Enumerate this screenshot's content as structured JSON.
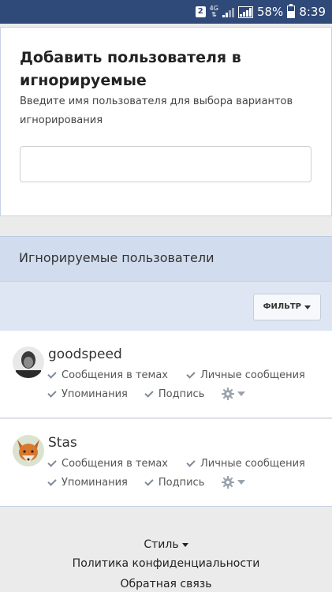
{
  "status_bar": {
    "sim_slot": "2",
    "network": "4G",
    "battery": "58%",
    "time": "8:39"
  },
  "add_box": {
    "title": "Добавить пользователя в игнорируемые",
    "hint": "Введите имя пользователя для выбора вариантов игнорирования",
    "input_value": "",
    "input_placeholder": ""
  },
  "ignored": {
    "title": "Игнорируемые пользователи",
    "filter_label": "ФИЛЬТР",
    "users": [
      {
        "name": "goodspeed",
        "options": [
          "Сообщения в темах",
          "Личные сообщения",
          "Упоминания",
          "Подпись"
        ]
      },
      {
        "name": "Stas",
        "options": [
          "Сообщения в темах",
          "Личные сообщения",
          "Упоминания",
          "Подпись"
        ]
      }
    ]
  },
  "footer": {
    "style": "Стиль",
    "privacy": "Политика конфиденциальности",
    "feedback": "Обратная связь"
  },
  "colors": {
    "status_bar": "#2f4a78",
    "section_header": "#d1ddee",
    "check": "#7e8a98"
  }
}
